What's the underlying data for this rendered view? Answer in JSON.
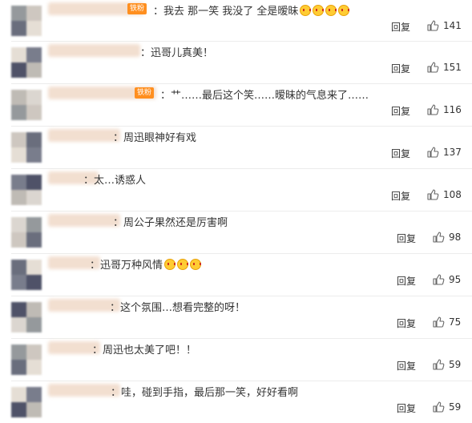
{
  "badge_label": "铁粉",
  "reply_label": "回复",
  "comments": [
    {
      "text": "：我去 那一笑 我没了 全是暧昧",
      "emojis": 4,
      "likes": "141"
    },
    {
      "text": "：迅哥儿真美！",
      "emojis": 0,
      "likes": "151"
    },
    {
      "text": "：艹……最后这个笑……暧昧的气息来了……",
      "emojis": 0,
      "likes": "116"
    },
    {
      "text": "：周迅眼神好有戏",
      "emojis": 0,
      "likes": "137"
    },
    {
      "text": "：太…诱惑人",
      "emojis": 0,
      "likes": "108"
    },
    {
      "text": "：周公子果然还是厉害啊",
      "emojis": 0,
      "likes": "98"
    },
    {
      "text": "：迅哥万种风情",
      "emojis": 3,
      "likes": "95"
    },
    {
      "text": "：这个氛围…想看完整的呀！",
      "emojis": 0,
      "likes": "75"
    },
    {
      "text": "：周迅也太美了吧！！",
      "emojis": 0,
      "likes": "59"
    },
    {
      "text": "：哇，碰到手指，最后那一笑，好好看啊",
      "emojis": 0,
      "likes": "59"
    }
  ],
  "colors": {
    "badge": "#ff8f1f",
    "avatar_palette": [
      "#8a8f92",
      "#c9c2ba",
      "#5a5f70",
      "#e3dbd1",
      "#6b6f80",
      "#3c4058",
      "#b9b4ad",
      "#d8d2cb"
    ],
    "name_blur": "#f2dfd0"
  }
}
